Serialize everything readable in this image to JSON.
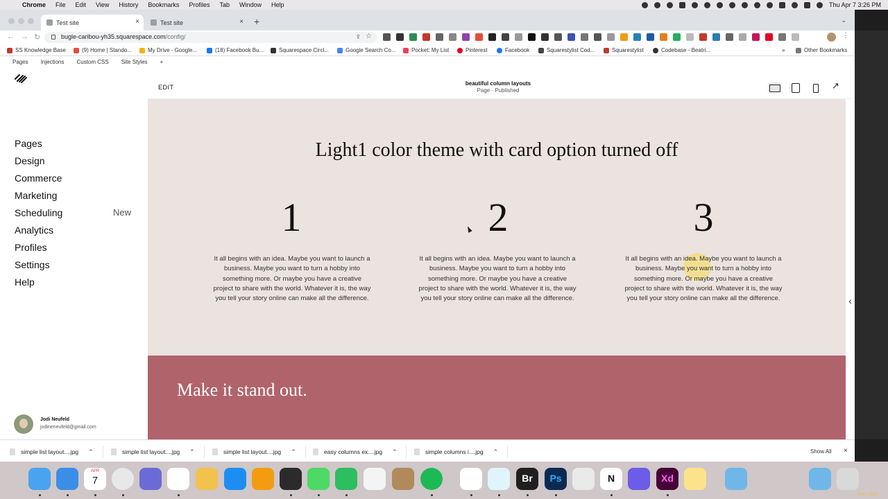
{
  "menubar": {
    "app": "Chrome",
    "items": [
      "File",
      "Edit",
      "View",
      "History",
      "Bookmarks",
      "Profiles",
      "Tab",
      "Window",
      "Help"
    ],
    "clock": "Thu Apr 7  3:26 PM"
  },
  "tabs": [
    {
      "title": "Test site",
      "active": true
    },
    {
      "title": "Test site",
      "active": false
    }
  ],
  "address": {
    "host": "bugle-caribou-yh35.squarespace.com",
    "path": "/config/"
  },
  "bookmarks": [
    {
      "label": "SS Knowledge Base",
      "color": "#c0392b"
    },
    {
      "label": "(9) Home | Stando...",
      "color": "#e74c3c"
    },
    {
      "label": "My Drive - Google...",
      "color": "#f4b400"
    },
    {
      "label": "(18) Facebook Bu...",
      "color": "#1877f2"
    },
    {
      "label": "Squarespace Circl...",
      "color": "#333333"
    },
    {
      "label": "Google Search Co...",
      "color": "#4285f4"
    },
    {
      "label": "Pocket: My List",
      "color": "#ef4056"
    },
    {
      "label": "Pinterest",
      "color": "#e60023"
    },
    {
      "label": "Facebook",
      "color": "#1877f2"
    },
    {
      "label": "Squarestylist Cod...",
      "color": "#444444"
    },
    {
      "label": "Squarestylist",
      "color": "#c0392b"
    },
    {
      "label": "Codebase - Beatri...",
      "color": "#333333"
    },
    {
      "label": "Other Bookmarks",
      "color": "#777777"
    }
  ],
  "sidebar": {
    "top_links": [
      "Pages",
      "Injections",
      "Custom CSS",
      "Site Styles"
    ],
    "nav": [
      "Pages",
      "Design",
      "Commerce",
      "Marketing",
      "Scheduling",
      "Analytics",
      "Profiles",
      "Settings",
      "Help"
    ],
    "new_badge": "New",
    "user": {
      "name": "Jodi Neufeld",
      "email": "jodineneufeld@gmail.com"
    }
  },
  "editor": {
    "edit_label": "EDIT",
    "page_title": "beautiful column layouts",
    "page_status": "Page · Published"
  },
  "canvas": {
    "heading": "Light1 color theme with card option turned off",
    "columns": [
      {
        "number": "1",
        "text": "It all begins with an idea. Maybe you want to launch a business. Maybe you want to turn a hobby into something more. Or maybe you have a creative project to share with the world. Whatever it is, the way you tell your story online can make all the difference."
      },
      {
        "number": "2",
        "text": "It all begins with an idea. Maybe you want to launch a business. Maybe you want to turn a hobby into something more. Or maybe you have a creative project to share with the world. Whatever it is, the way you tell your story online can make all the difference."
      },
      {
        "number": "3",
        "text": "It all begins with an idea. Maybe you want to launch a business. Maybe you want to turn a hobby into something more. Or maybe you have a creative project to share with the world. Whatever it is, the way you tell your story online can make all the difference."
      }
    ],
    "section2_heading": "Make it stand out.",
    "section2_color": "#b0636b",
    "background_color": "#ebe3df"
  },
  "downloads": {
    "items": [
      "simple list layout....jpg",
      "simple list layout....jpg",
      "simple list layout....jpg",
      "easy columns ex....jpg",
      "simple columns i....jpg"
    ],
    "show_all": "Show All"
  },
  "dock": {
    "calendar_month": "APR",
    "calendar_day": "7",
    "date_fragment": "ober 2021"
  }
}
